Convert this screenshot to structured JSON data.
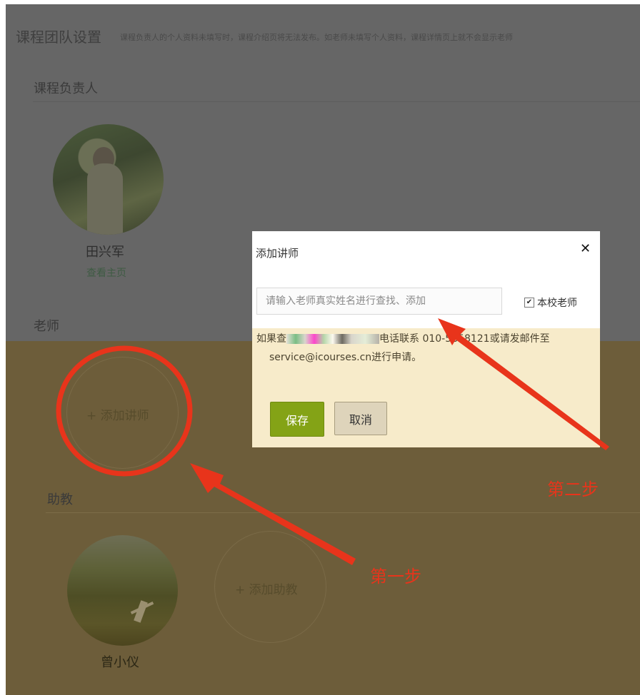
{
  "page": {
    "title": "课程团队设置",
    "title_note": "课程负责人的个人资料未填写时，课程介绍页将无法发布。如老师未填写个人资料，课程详情页上就不会显示老师"
  },
  "sections": {
    "owner_label": "课程负责人",
    "teacher_label": "老师",
    "assistant_label": "助教"
  },
  "owner": {
    "name": "田兴军",
    "link": "查看主页"
  },
  "teacher_add": {
    "label": "+ 添加讲师"
  },
  "assistant": {
    "name": "曾小仪",
    "add_label": "+ 添加助教"
  },
  "dialog": {
    "title": "添加讲师",
    "close": "✕",
    "search_placeholder": "请输入老师真实姓名进行查找、添加",
    "checkbox_label": "本校老师",
    "checkbox_checked": true,
    "hint_line1_a": "如果查",
    "hint_line1_b": "电话联系 010-5858121",
    "hint_line1_c": "或请发邮件至",
    "hint_line2": "service@icourses.cn进行申请。",
    "save": "保存",
    "cancel": "取消"
  },
  "annotations": {
    "step1": "第一步",
    "step2": "第二步",
    "color": "#e8341b"
  },
  "colors": {
    "overlay_top": "#666666",
    "overlay_bottom": "#6d5d3a",
    "save_button": "#84a316",
    "dialog_bottom": "#f7ebca"
  }
}
